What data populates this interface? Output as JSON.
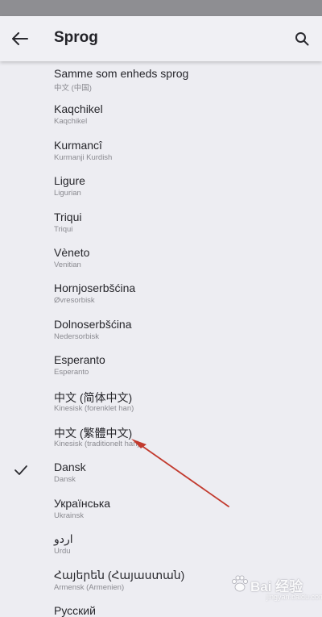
{
  "header": {
    "title": "Sprog",
    "back_icon": "arrow-left-icon",
    "search_icon": "search-icon"
  },
  "languages": [
    {
      "name": "Samme som enheds sprog",
      "subtitle": "中文 (中国)",
      "selected": false
    },
    {
      "name": "Kaqchikel",
      "subtitle": "Kaqchikel",
      "selected": false
    },
    {
      "name": "Kurmancî",
      "subtitle": "Kurmanji Kurdish",
      "selected": false
    },
    {
      "name": "Ligure",
      "subtitle": "Ligurian",
      "selected": false
    },
    {
      "name": "Triqui",
      "subtitle": "Triqui",
      "selected": false
    },
    {
      "name": "Vèneto",
      "subtitle": "Venitian",
      "selected": false
    },
    {
      "name": "Hornjoserbšćina",
      "subtitle": "Øvresorbisk",
      "selected": false
    },
    {
      "name": "Dolnoserbšćina",
      "subtitle": "Nedersorbisk",
      "selected": false
    },
    {
      "name": "Esperanto",
      "subtitle": "Esperanto",
      "selected": false
    },
    {
      "name": "中文 (简体中文)",
      "subtitle": "Kinesisk (forenklet han)",
      "selected": false
    },
    {
      "name": "中文 (繁體中文)",
      "subtitle": "Kinesisk (traditionelt han)",
      "selected": false
    },
    {
      "name": "Dansk",
      "subtitle": "Dansk",
      "selected": true
    },
    {
      "name": "Українська",
      "subtitle": "Ukrainsk",
      "selected": false
    },
    {
      "name": "اردو",
      "subtitle": "Urdu",
      "selected": false
    },
    {
      "name": "Հայերեն (Հայաստան)",
      "subtitle": "Armensk (Armenien)",
      "selected": false
    },
    {
      "name": "Русский",
      "subtitle": "",
      "selected": false
    }
  ],
  "watermark": {
    "text": "Bai 经验",
    "sub": "jingyan.baidu.com"
  },
  "colors": {
    "background": "#ededf2",
    "status_bar": "#8e8e92",
    "annotation_arrow": "#c23a2e",
    "check": "#2b2b30"
  }
}
